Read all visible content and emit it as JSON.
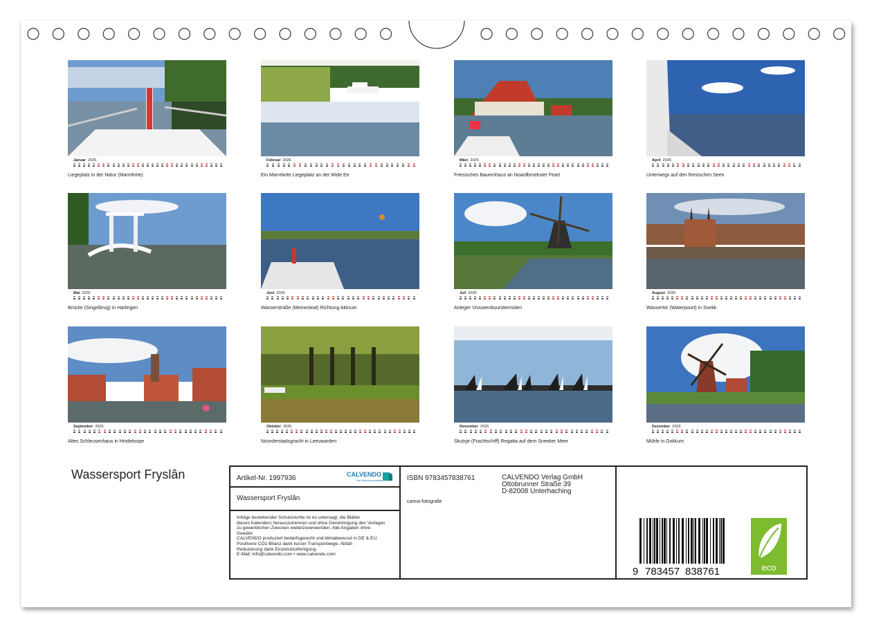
{
  "calendar_title": "Wassersport Fryslân",
  "year": "2026",
  "months": [
    {
      "name": "Januar",
      "caption": "Liegeplatz in der Natur (Marrekrite)",
      "days": 31
    },
    {
      "name": "Februar",
      "caption": "Ein Marrekrite Liegeplatz an der Wide Ee",
      "days": 28
    },
    {
      "name": "März",
      "caption": "Friesisches Bauernhaus an Noardbroekster Feart",
      "days": 31
    },
    {
      "name": "April",
      "caption": "Unterwegs auf den friesischen Seen",
      "days": 30
    },
    {
      "name": "Mai",
      "caption": "Brücke (Singelbrug) in Harlingen",
      "days": 31
    },
    {
      "name": "Juni",
      "caption": "Wasserstraße (Meinesleat) Richtung Akkrum",
      "days": 30
    },
    {
      "name": "Juli",
      "caption": "Anleger Vrouwenbuurstermolen",
      "days": 31
    },
    {
      "name": "August",
      "caption": "Wassertor (Waterpoort) in Snekk",
      "days": 31
    },
    {
      "name": "September",
      "caption": "Altes Schleusenhaus in Hindeloope",
      "days": 30
    },
    {
      "name": "Oktober",
      "caption": "Noorderstadsgracht in Leeuwarden",
      "days": 31
    },
    {
      "name": "November",
      "caption": "Skutsje (Frachtschiff) Regatta auf dem Sneeker Meer",
      "days": 30
    },
    {
      "name": "Dezember",
      "caption": "Mühle in Dokkum",
      "days": 31
    }
  ],
  "info": {
    "article_no": "Artikel-Nr. 1997936",
    "title": "Wassersport Fryslân",
    "legal_lines": [
      "Infolge bestehender Schutzrechte ist es untersagt, die Blätter",
      "dieses Kalenders herauszutrennen und ohne Genehmigung des Verlages",
      "zu gewerblichen Zwecken weiterzuverwenden. Alle Angaben ohne",
      "Gewähr.",
      "CALVENDO produziert bedarfsgerecht und klimabewusst in DE & EU.",
      "Positivere CO2-Bilanz dank kurzer Transportwege. Abfall-",
      "Reduzierung dank Einzelstückfertigung.",
      "E-Mail: info@calvendo.com • www.calvendo.com"
    ],
    "isbn": "ISBN 9783457838761",
    "publisher_lines": [
      "CALVENDO Verlag GmbH",
      "Ottobrunner Straße 39",
      "D-82008 Unterhaching"
    ],
    "author": "carina-fotografie",
    "barcode_digits": {
      "first": "9",
      "group1": "783457",
      "group2": "838761"
    },
    "logo_text": "CALVENDO",
    "logo_sub": "Ihre Kalendermanufaktur",
    "eco_label": "eco"
  },
  "colors": {
    "border": "#222222",
    "eco_green": "#7dbb2f",
    "weekend": "#c05050",
    "sky": "#4f86c8",
    "water": "#3a5570"
  }
}
